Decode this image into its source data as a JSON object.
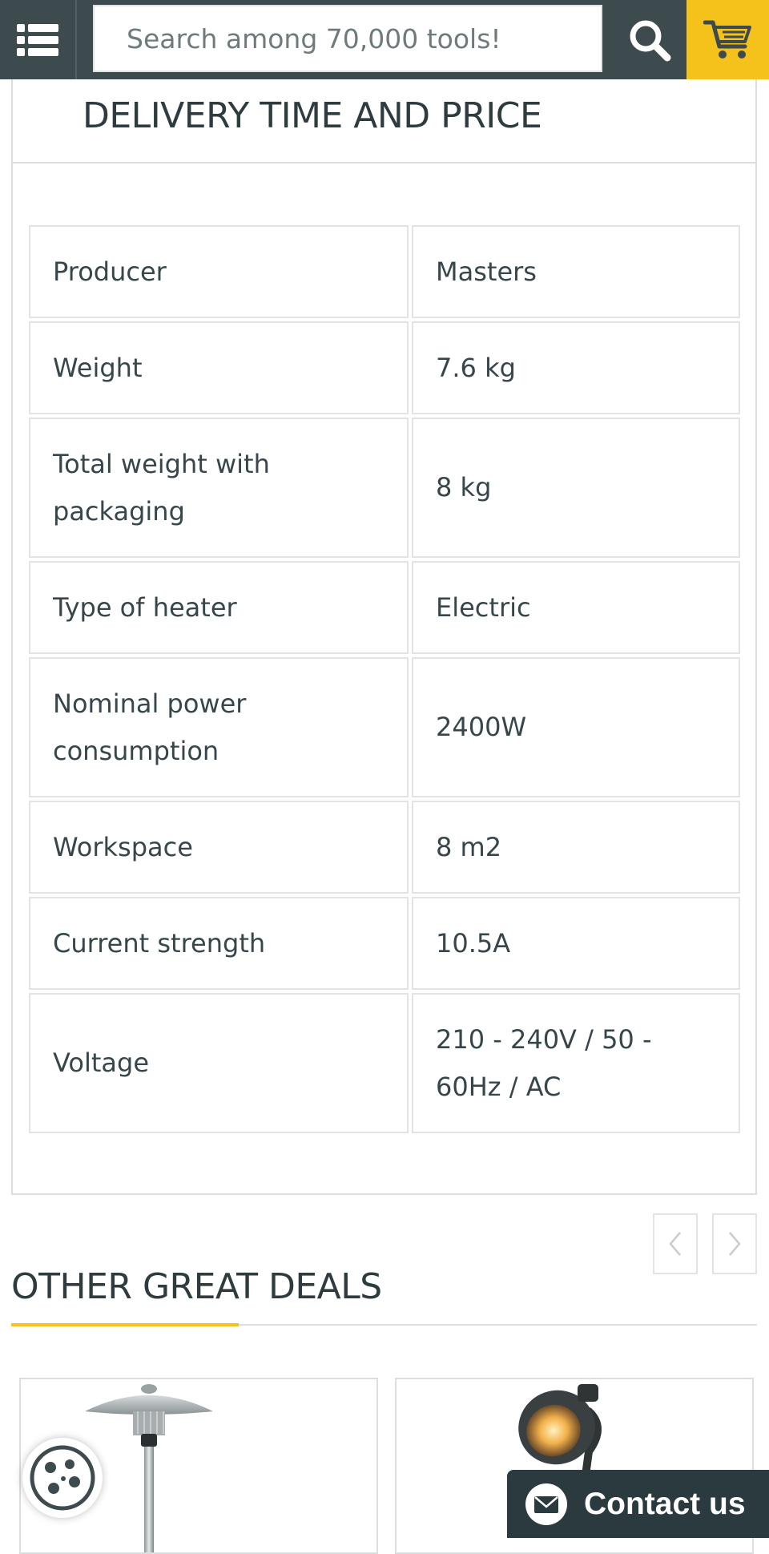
{
  "header": {
    "menu_icon": "list-menu-icon",
    "search": {
      "placeholder": "Search among 70,000 tools!",
      "value": ""
    },
    "search_icon": "search-icon",
    "cart_icon": "cart-icon",
    "colors": {
      "bar": "#3d4a4e",
      "cart_bg": "#f4c21b"
    }
  },
  "specs": {
    "title": "DELIVERY TIME AND PRICE",
    "rows": [
      {
        "label": "Producer",
        "value": "Masters"
      },
      {
        "label": "Weight",
        "value": "7.6 kg"
      },
      {
        "label": "Total weight with packaging",
        "value": "8 kg"
      },
      {
        "label": "Type of heater",
        "value": "Electric"
      },
      {
        "label": "Nominal power consumption",
        "value": "2400W"
      },
      {
        "label": "Workspace",
        "value": "8 m2"
      },
      {
        "label": "Current strength",
        "value": "10.5A"
      },
      {
        "label": "Voltage",
        "value": "210 - 240V / 50 - 60Hz / AC"
      }
    ]
  },
  "deals": {
    "title": "OTHER GREAT DEALS",
    "prev_icon": "chevron-left-icon",
    "next_icon": "chevron-right-icon",
    "accent_color": "#f4c21b",
    "products": [
      {
        "image": "patio-heater-standing-product-image"
      },
      {
        "image": "wall-lamp-heater-product-image"
      }
    ]
  },
  "widgets": {
    "cookie_icon": "cookie-icon",
    "contact": {
      "label": "Contact us",
      "icon": "envelope-icon"
    }
  }
}
